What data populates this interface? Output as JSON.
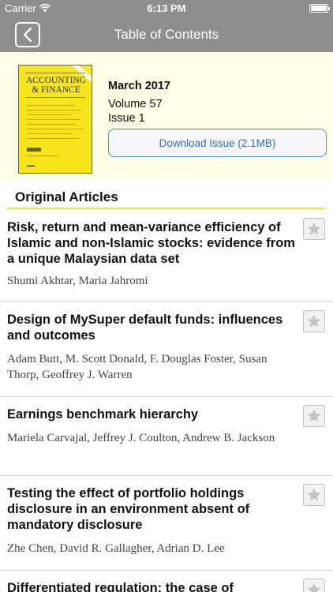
{
  "status_bar": {
    "carrier": "Carrier",
    "time": "6:13 PM"
  },
  "nav": {
    "title": "Table of Contents"
  },
  "issue": {
    "cover_title_line1": "ACCOUNTING",
    "cover_title_line2": "& FINANCE",
    "date": "March 2017",
    "volume": "Volume 57",
    "issue": "Issue 1",
    "download_label": "Download Issue (2.1MB)"
  },
  "section": {
    "title": "Original Articles"
  },
  "articles": [
    {
      "title": "Risk, return and mean-variance efficiency of Islamic and non-Islamic stocks: evidence from a unique Malaysian data set",
      "authors": "Shumi Akhtar, Maria Jahromi"
    },
    {
      "title": "Design of MySuper default funds: influences and outcomes",
      "authors": "Adam Butt, M. Scott Donald, F. Douglas Foster, Susan Thorp, Geoffrey J. Warren"
    },
    {
      "title": "Earnings benchmark hierarchy",
      "authors": "Mariela Carvajal, Jeffrey J. Coulton, Andrew B. Jackson"
    },
    {
      "title": "Testing the effect of portfolio holdings disclosure in an environment absent of mandatory disclosure",
      "authors": "Zhe Chen, David R. Gallagher, Adrian D. Lee"
    },
    {
      "title": "Differentiated regulation: the case of",
      "authors": ""
    }
  ],
  "icons": {
    "back": "chevron-left-icon",
    "favorite": "star-icon",
    "wifi": "wifi-icon",
    "battery": "battery-icon"
  },
  "colors": {
    "bar_background": "#8e8e8e",
    "header_background": "#fefde6",
    "accent_blue": "#2a6fc3",
    "section_rule": "#e6de4a"
  }
}
